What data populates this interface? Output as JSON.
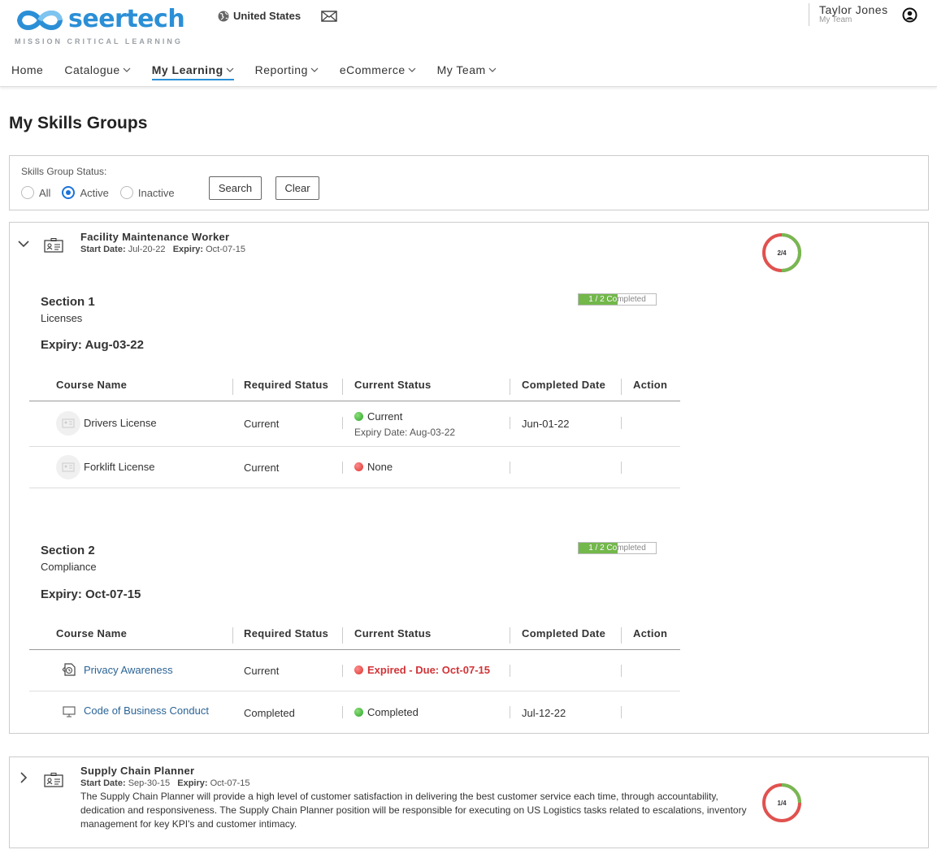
{
  "header": {
    "logo_text": "seertech",
    "logo_tagline": "MISSION CRITICAL LEARNING",
    "country": "United States",
    "user_name": "Taylor Jones",
    "user_sub": "My Team",
    "brand_color": "#2b8fd6"
  },
  "nav": {
    "items": [
      {
        "label": "Home",
        "dropdown": false
      },
      {
        "label": "Catalogue",
        "dropdown": true
      },
      {
        "label": "My Learning",
        "dropdown": true,
        "active": true
      },
      {
        "label": "Reporting",
        "dropdown": true
      },
      {
        "label": "eCommerce",
        "dropdown": true
      },
      {
        "label": "My Team",
        "dropdown": true
      }
    ]
  },
  "page": {
    "title": "My Skills Groups"
  },
  "filter": {
    "label": "Skills Group Status:",
    "options": [
      "All",
      "Active",
      "Inactive"
    ],
    "selected": "Active",
    "search_label": "Search",
    "clear_label": "Clear"
  },
  "table_headers": {
    "course_name": "Course Name",
    "required_status": "Required Status",
    "current_status": "Current Status",
    "completed_date": "Completed Date",
    "action": "Action"
  },
  "groups": [
    {
      "title": "Facility Maintenance Worker",
      "start_label": "Start Date:",
      "start_date": "Jul-20-22",
      "expiry_label": "Expiry:",
      "expiry_date": "Oct-07-15",
      "progress_label": "2/4",
      "progress_fraction": 0.5,
      "expanded": true,
      "sections": [
        {
          "title": "Section 1",
          "subtitle": "Licenses",
          "expiry": "Expiry: Aug-03-22",
          "progress_label": "1 / 2 Completed",
          "progress_fraction": 0.5,
          "rows": [
            {
              "name": "Drivers License",
              "icon": "license-icon",
              "link": false,
              "required": "Current",
              "status": "Current",
              "status_color": "green",
              "status_sub": "Expiry Date: Aug-03-22",
              "completed": "Jun-01-22"
            },
            {
              "name": "Forklift License",
              "icon": "license-icon",
              "link": false,
              "required": "Current",
              "status": "None",
              "status_color": "red",
              "status_sub": "",
              "completed": ""
            }
          ]
        },
        {
          "title": "Section 2",
          "subtitle": "Compliance",
          "expiry": "Expiry: Oct-07-15",
          "progress_label": "1 / 2 Completed",
          "progress_fraction": 0.5,
          "rows": [
            {
              "name": "Privacy Awareness",
              "icon": "elearning-icon",
              "link": true,
              "required": "Current",
              "status": "Expired - Due: Oct-07-15",
              "status_color": "red",
              "status_sub": "",
              "completed": ""
            },
            {
              "name": "Code of Business Conduct",
              "icon": "monitor-icon",
              "link": true,
              "required": "Completed",
              "status": "Completed",
              "status_color": "green",
              "status_sub": "",
              "completed": "Jul-12-22"
            }
          ]
        }
      ]
    },
    {
      "title": "Supply Chain Planner",
      "start_label": "Start Date:",
      "start_date": "Sep-30-15",
      "expiry_label": "Expiry:",
      "expiry_date": "Oct-07-15",
      "description": "The Supply Chain Planner will provide a high level of customer satisfaction in delivering the best customer service each time, through accountability, dedication and responsiveness. The Supply Chain Planner position will be responsible for executing on US Logistics tasks related to escalations, inventory management for key KPI's and customer intimacy.",
      "progress_label": "1/4",
      "progress_fraction": 0.25,
      "expanded": false
    }
  ]
}
